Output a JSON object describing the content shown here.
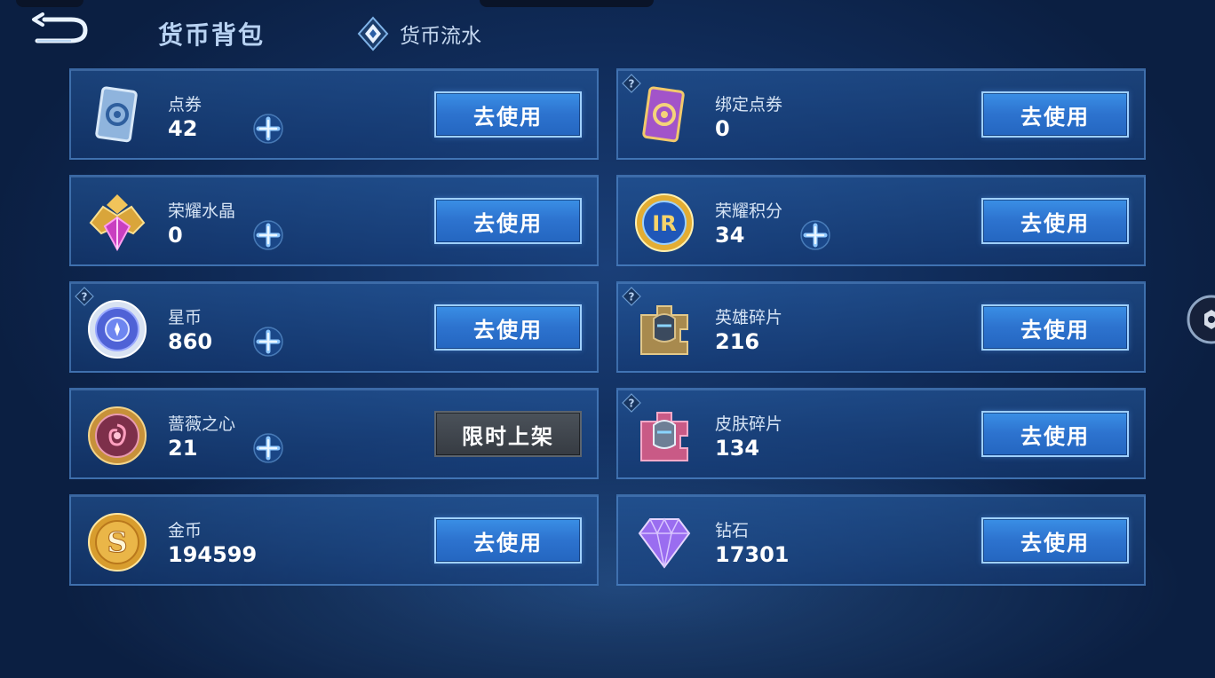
{
  "header": {
    "title": "货币背包",
    "flow_label": "货币流水"
  },
  "currencies": [
    {
      "name": "点券",
      "amount": "42",
      "button": "去使用",
      "icon": "coupon-card-icon"
    },
    {
      "name": "绑定点券",
      "amount": "0",
      "button": "去使用",
      "icon": "bound-coupon-card-icon"
    },
    {
      "name": "荣耀水晶",
      "amount": "0",
      "button": "去使用",
      "icon": "glory-crystal-icon"
    },
    {
      "name": "荣耀积分",
      "amount": "34",
      "button": "去使用",
      "icon": "glory-points-coin-icon"
    },
    {
      "name": "星币",
      "amount": "860",
      "button": "去使用",
      "icon": "star-coin-icon"
    },
    {
      "name": "英雄碎片",
      "amount": "216",
      "button": "去使用",
      "icon": "hero-fragment-icon"
    },
    {
      "name": "蔷薇之心",
      "amount": "21",
      "button": "限时上架",
      "icon": "rose-heart-coin-icon"
    },
    {
      "name": "皮肤碎片",
      "amount": "134",
      "button": "去使用",
      "icon": "skin-fragment-icon"
    },
    {
      "name": "金币",
      "amount": "194599",
      "button": "去使用",
      "icon": "gold-coin-icon"
    },
    {
      "name": "钻石",
      "amount": "17301",
      "button": "去使用",
      "icon": "diamond-icon"
    }
  ],
  "colors": {
    "background": "#102c5a",
    "button_blue": "#2d73cf",
    "button_grey": "#3f454c",
    "card_border": "#5c96d7"
  }
}
